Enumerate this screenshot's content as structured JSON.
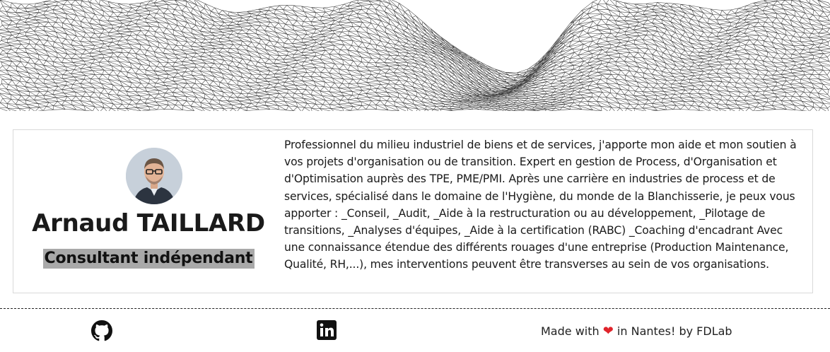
{
  "profile": {
    "name": "Arnaud TAILLARD",
    "role": "Consultant indépendant"
  },
  "bio": "Professionnel du milieu industriel de biens et de services, j'apporte mon aide et mon soutien à vos projets d'organisation ou de transition. Expert en gestion de Process, d'Organisation et d'Optimisation auprès des TPE, PME/PMI. Après une carrière en industries de process et de services, spécialisé dans le domaine de l'Hygiène, du monde de la Blanchisserie, je peux vous apporter : _Conseil, _Audit, _Aide à la restructuration ou au développement, _Pilotage de transitions, _Analyses d'équipes, _Aide à la certification (RABC) _Coaching d'encadrant Avec une connaissance étendue des différents rouages d'une entreprise (Production Maintenance, Qualité, RH,...), mes interventions peuvent être transverses au sein de vos organisations.",
  "footer": {
    "made_prefix": "Made with",
    "made_suffix": "in Nantes! by FDLab",
    "heart_color": "#e0242b"
  },
  "icons": {
    "github": "github-icon",
    "linkedin": "linkedin-icon",
    "heart": "heart-icon"
  }
}
